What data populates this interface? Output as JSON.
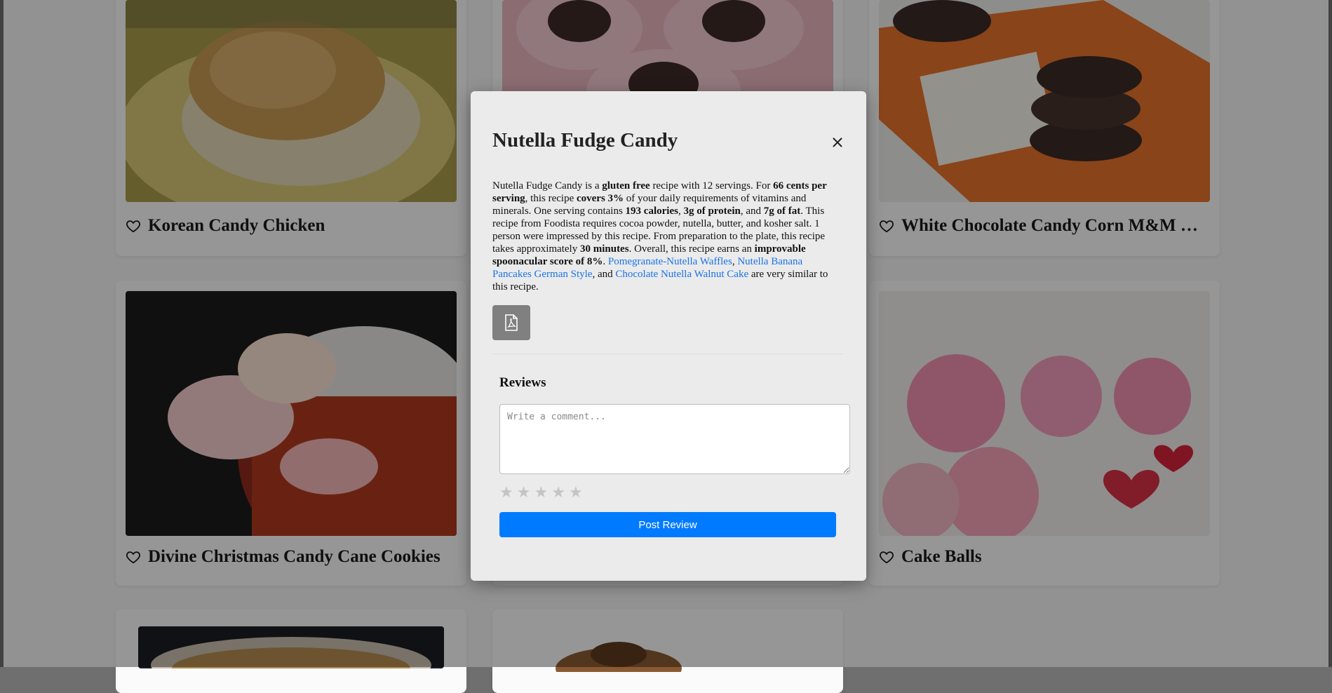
{
  "cards": [
    {
      "title": "Korean Candy Chicken"
    },
    {
      "title": ""
    },
    {
      "title": "White Chocolate Candy Corn M&M Br…"
    },
    {
      "title": "Divine Christmas Candy Cane Cookies"
    },
    {
      "title": ""
    },
    {
      "title": "Cake Balls"
    }
  ],
  "modal": {
    "title": "Nutella Fudge Candy",
    "description": {
      "t1": "Nutella Fudge Candy is a ",
      "b1": "gluten free",
      "t2": " recipe with 12 servings. For ",
      "b2": "66 cents per serving",
      "t3": ", this recipe ",
      "b3": "covers 3%",
      "t4": " of your daily requirements of vitamins and minerals. One serving contains ",
      "b4": "193 calories",
      "t5": ", ",
      "b5": "3g of protein",
      "t6": ", and ",
      "b6": "7g of fat",
      "t7": ". This recipe from Foodista requires cocoa powder, nutella, butter, and kosher salt. 1 person were impressed by this recipe. From preparation to the plate, this recipe takes approximately ",
      "b7": "30 minutes",
      "t8": ". Overall, this recipe earns an ",
      "b8": "improvable spoonacular score of 8%",
      "t9": ". ",
      "link1": "Pomegranate-Nutella Waffles",
      "t10": ", ",
      "link2": "Nutella Banana Pancakes German Style",
      "t11": ", and ",
      "link3": "Chocolate Nutella Walnut Cake",
      "t12": " are very similar to this recipe."
    },
    "pdf_icon": "pdf-file-icon",
    "reviews_heading": "Reviews",
    "comment_placeholder": "Write a comment...",
    "rating": 0,
    "post_label": "Post Review",
    "close_icon": "close-icon"
  },
  "colors": {
    "accent": "#007bff",
    "link": "#1a73e8",
    "star": "#c4c4c4",
    "pdf_button": "#808080"
  }
}
